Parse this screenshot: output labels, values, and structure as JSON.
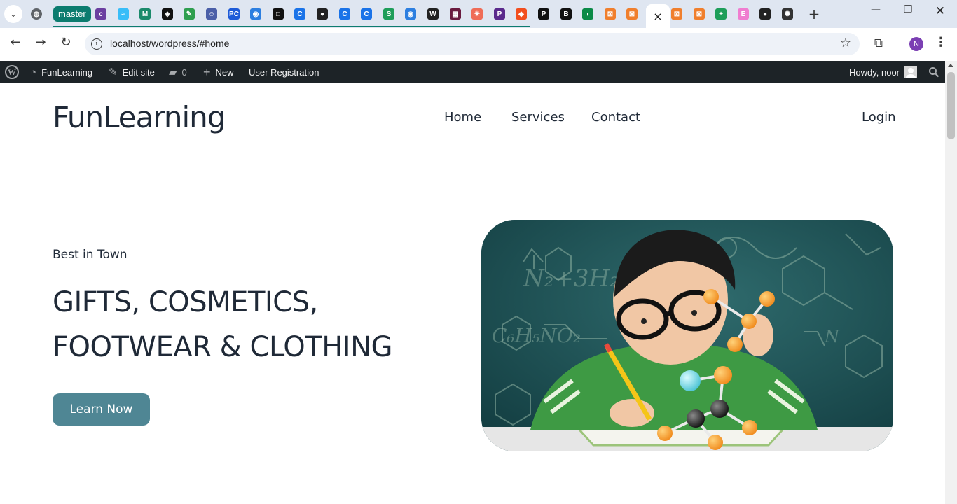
{
  "browser": {
    "tab_group_label": "master",
    "active_tab_close": "×",
    "new_tab": "+",
    "url": "localhost/wordpress/#home",
    "profile_initial": "N",
    "tab_favicons": [
      {
        "name": "globe-favicon",
        "color": "#5f6368",
        "glyph": "◍"
      },
      {
        "name": "colorlib-favicon",
        "color": "#6b3fa0",
        "glyph": "c"
      },
      {
        "name": "tailwind-favicon",
        "color": "#38bdf8",
        "glyph": "≈"
      },
      {
        "name": "mdn-favicon",
        "color": "#1b8a6b",
        "glyph": "M"
      },
      {
        "name": "codepen-favicon",
        "color": "#111111",
        "glyph": "◈"
      },
      {
        "name": "leaf-favicon",
        "color": "#2e9e4f",
        "glyph": "✎"
      },
      {
        "name": "wizard-favicon",
        "color": "#4b5fa8",
        "glyph": "☺"
      },
      {
        "name": "pc-favicon",
        "color": "#1e5bd8",
        "glyph": "PC"
      },
      {
        "name": "target-favicon",
        "color": "#2d7fe0",
        "glyph": "◉"
      },
      {
        "name": "square-favicon",
        "color": "#111111",
        "glyph": "□"
      },
      {
        "name": "copilot-favicon",
        "color": "#1a73e8",
        "glyph": "C"
      },
      {
        "name": "github-favicon",
        "color": "#222222",
        "glyph": "●"
      },
      {
        "name": "copilot-favicon",
        "color": "#1a73e8",
        "glyph": "C"
      },
      {
        "name": "copilot-favicon",
        "color": "#1a73e8",
        "glyph": "C"
      },
      {
        "name": "s-favicon",
        "color": "#1e9e5a",
        "glyph": "S"
      },
      {
        "name": "target-favicon",
        "color": "#2d7fe0",
        "glyph": "◉"
      },
      {
        "name": "wikipedia-favicon",
        "color": "#222222",
        "glyph": "W"
      },
      {
        "name": "grid-favicon",
        "color": "#6a1b3f",
        "glyph": "▦"
      },
      {
        "name": "postman-favicon",
        "color": "#ef6c57",
        "glyph": "✷"
      },
      {
        "name": "php-favicon",
        "color": "#5a2a8c",
        "glyph": "P"
      },
      {
        "name": "figma-favicon",
        "color": "#f24e1e",
        "glyph": "◆"
      },
      {
        "name": "paypal-favicon",
        "color": "#111111",
        "glyph": "P"
      },
      {
        "name": "bootstrap-favicon",
        "color": "#111111",
        "glyph": "B"
      },
      {
        "name": "mongodb-favicon",
        "color": "#0b8a47",
        "glyph": "◗"
      },
      {
        "name": "xampp-favicon",
        "color": "#f07f2d",
        "glyph": "⊠"
      },
      {
        "name": "xampp-favicon",
        "color": "#f07f2d",
        "glyph": "⊠"
      },
      {
        "name": "xampp-favicon",
        "color": "#f07f2d",
        "glyph": "⊠"
      },
      {
        "name": "xampp-favicon",
        "color": "#f07f2d",
        "glyph": "⊠"
      },
      {
        "name": "sheets-favicon",
        "color": "#1e9e5a",
        "glyph": "+"
      },
      {
        "name": "elementor-favicon",
        "color": "#f07dd0",
        "glyph": "E"
      },
      {
        "name": "github-favicon",
        "color": "#222222",
        "glyph": "●"
      },
      {
        "name": "chatgpt-favicon",
        "color": "#333333",
        "glyph": "✺"
      }
    ]
  },
  "adminbar": {
    "site_name": "FunLearning",
    "edit_site": "Edit site",
    "comments_count": "0",
    "new_label": "New",
    "user_registration": "User Registration",
    "greeting": "Howdy, noor"
  },
  "site": {
    "title": "FunLearning",
    "nav": {
      "home": "Home",
      "services": "Services",
      "contact": "Contact",
      "login": "Login"
    }
  },
  "hero": {
    "eyebrow": "Best in Town",
    "headline_line1": "GIFTS, COSMETICS,",
    "headline_line2": "FOOTWEAR & CLOTHING",
    "cta_label": "Learn Now"
  },
  "colors": {
    "cta_background": "#4f8694",
    "adminbar_background": "#1d2327",
    "tabstrip_background": "#dfe6f1",
    "tab_group": "#0c7c6f",
    "text_primary": "#1f2937"
  }
}
